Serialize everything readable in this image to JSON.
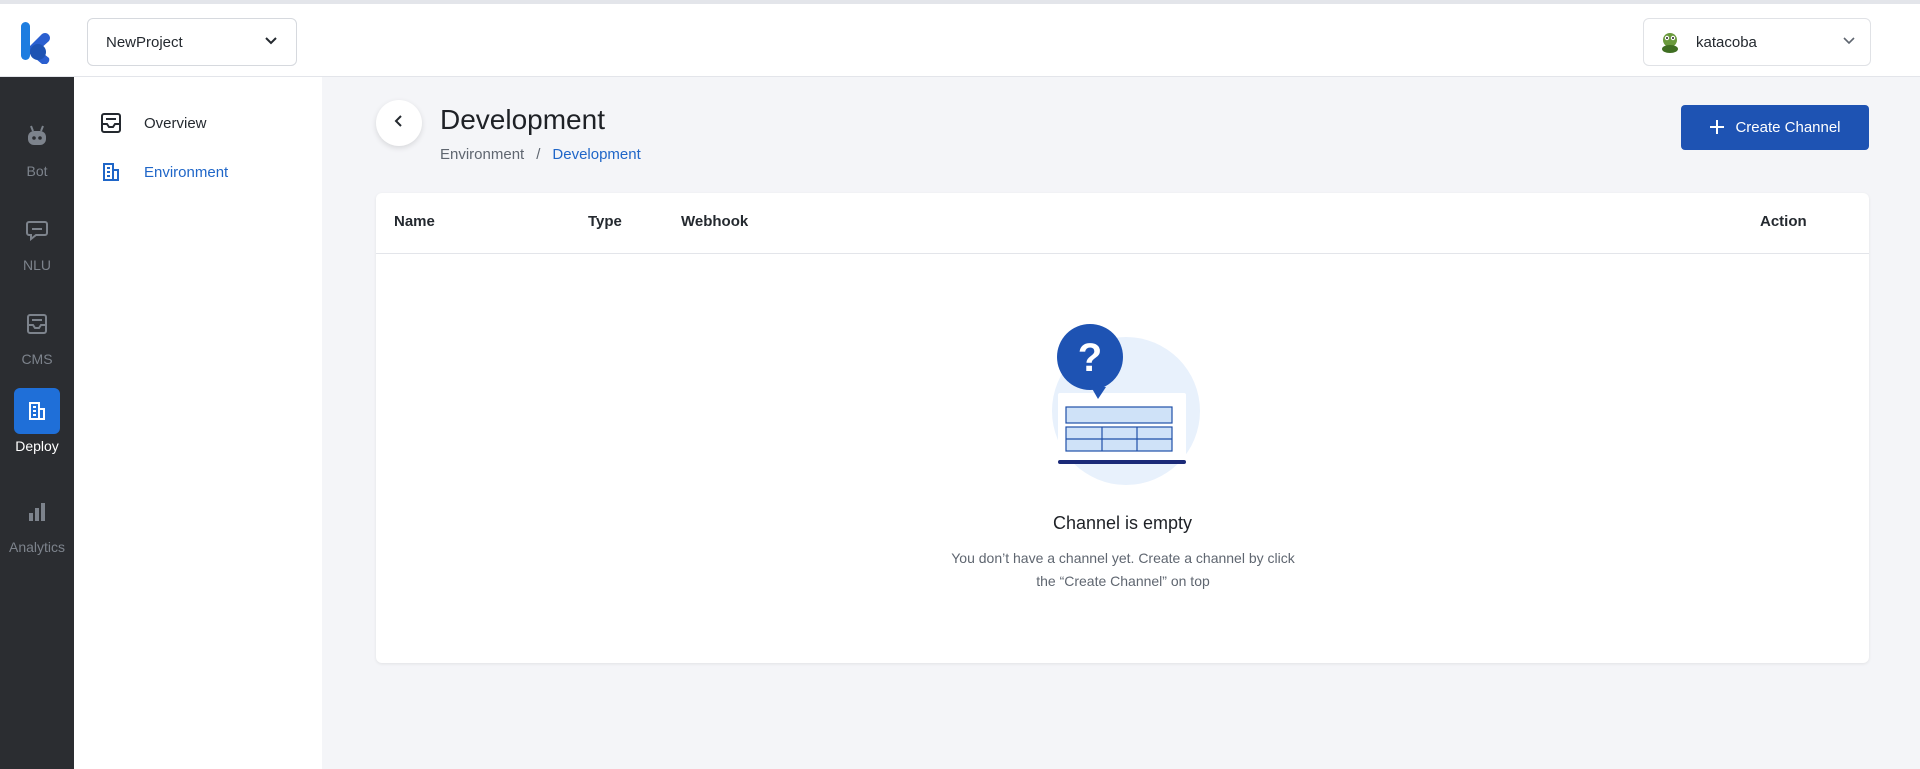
{
  "header": {
    "project_selector": {
      "value": "NewProject"
    },
    "user_menu": {
      "username": "katacoba"
    }
  },
  "rail": {
    "items": [
      {
        "label": "Bot",
        "icon": "bot-icon"
      },
      {
        "label": "NLU",
        "icon": "chat-icon"
      },
      {
        "label": "CMS",
        "icon": "inbox-icon"
      },
      {
        "label": "Deploy",
        "icon": "building-icon",
        "active": true
      },
      {
        "label": "Analytics",
        "icon": "bar-chart-icon"
      }
    ]
  },
  "subnav": {
    "items": [
      {
        "label": "Overview",
        "icon": "inbox-icon"
      },
      {
        "label": "Environment",
        "icon": "building-icon",
        "active": true
      }
    ]
  },
  "page": {
    "title": "Development",
    "breadcrumb": [
      "Environment",
      "Development"
    ],
    "breadcrumb_separator": "/",
    "create_button": "Create Channel"
  },
  "table": {
    "columns": [
      "Name",
      "Type",
      "Webhook",
      "Action"
    ]
  },
  "empty_state": {
    "title": "Channel is empty",
    "description_line1": "You don’t have a channel yet. Create a channel by click",
    "description_line2": "the “Create Channel” on top"
  },
  "colors": {
    "accent": "#1e53b3",
    "active_link": "#1f66c8",
    "rail_bg": "#2b2d31",
    "rail_active": "#1f6fd8"
  }
}
